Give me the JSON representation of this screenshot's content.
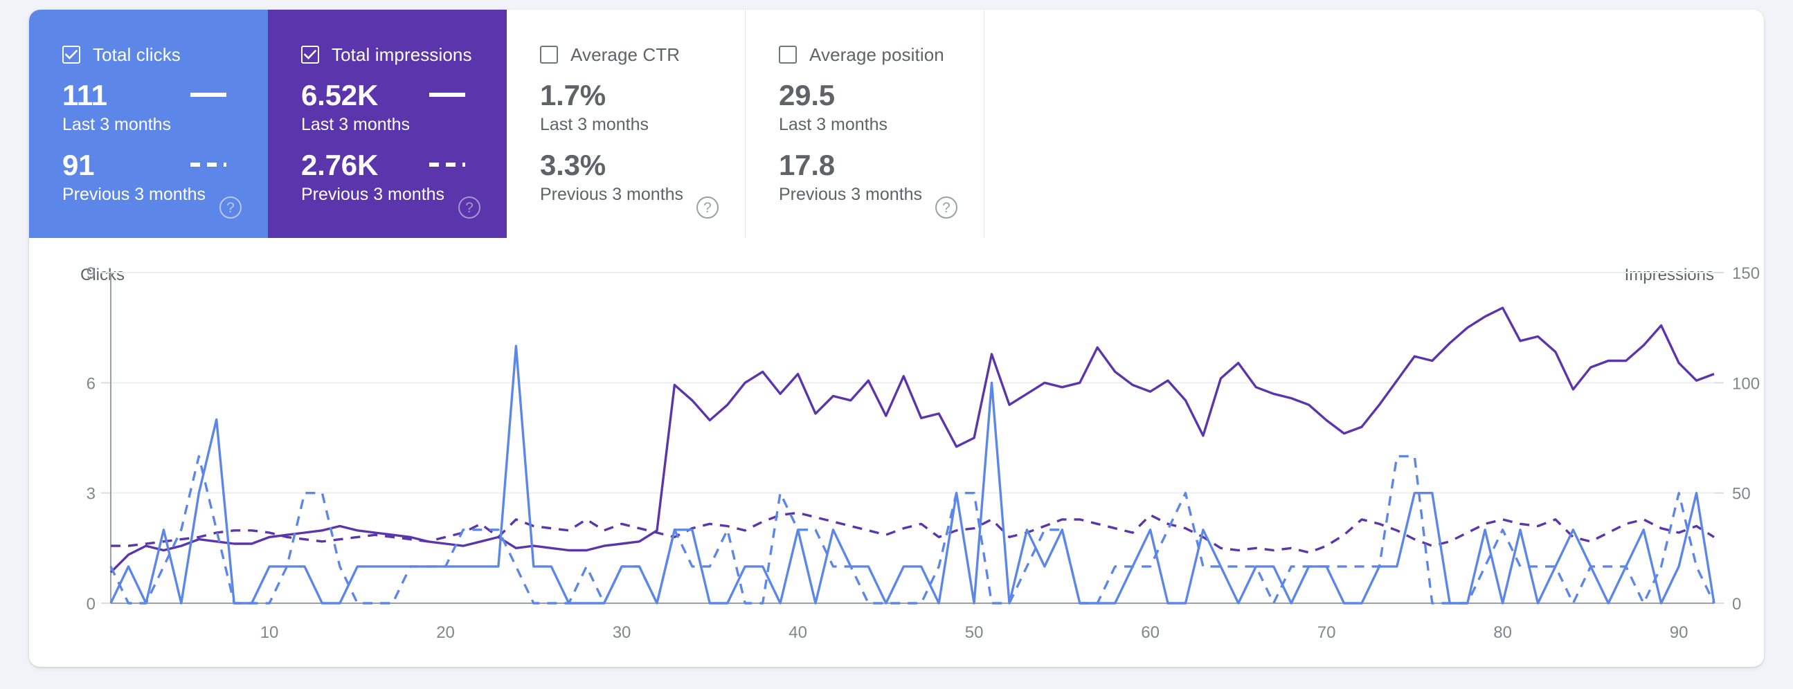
{
  "cards": [
    {
      "label": "Total clicks",
      "checked": true,
      "state": "active-clicks",
      "current_value": "111",
      "current_label": "Last 3 months",
      "previous_value": "91",
      "previous_label": "Previous 3 months",
      "help_glyph": "?",
      "accent": "#5c87e8"
    },
    {
      "label": "Total impressions",
      "checked": true,
      "state": "active-impr",
      "current_value": "6.52K",
      "current_label": "Last 3 months",
      "previous_value": "2.76K",
      "previous_label": "Previous 3 months",
      "help_glyph": "?",
      "accent": "#5b35ab"
    },
    {
      "label": "Average CTR",
      "checked": false,
      "state": "",
      "current_value": "1.7%",
      "current_label": "Last 3 months",
      "previous_value": "3.3%",
      "previous_label": "Previous 3 months",
      "help_glyph": "?",
      "accent": "#ffffff"
    },
    {
      "label": "Average position",
      "checked": false,
      "state": "",
      "current_value": "29.5",
      "current_label": "Last 3 months",
      "previous_value": "17.8",
      "previous_label": "Previous 3 months",
      "help_glyph": "?",
      "accent": "#ffffff"
    }
  ],
  "chart_data": {
    "type": "line",
    "title": "",
    "xlabel": "",
    "ylabel": "Clicks",
    "y2label": "Impressions",
    "ylim": [
      0,
      9
    ],
    "y2lim": [
      0,
      150
    ],
    "yticks": [
      "0",
      "3",
      "6",
      "9"
    ],
    "y2ticks": [
      "0",
      "50",
      "100",
      "150"
    ],
    "xticks": [
      "10",
      "20",
      "30",
      "40",
      "50",
      "60",
      "70",
      "80",
      "90"
    ],
    "xlim": [
      1,
      92
    ],
    "grid": true,
    "legend_position": "none",
    "series": [
      {
        "name": "Total clicks",
        "axis": "left",
        "color": "#5c87e8",
        "style": "solid",
        "values": [
          0,
          1,
          0,
          2,
          0,
          3,
          5,
          0,
          0,
          1,
          1,
          1,
          0,
          0,
          1,
          1,
          1,
          1,
          1,
          1,
          1,
          1,
          1,
          7,
          1,
          1,
          0,
          0,
          0,
          1,
          1,
          0,
          2,
          2,
          0,
          0,
          1,
          1,
          0,
          2,
          0,
          2,
          1,
          1,
          0,
          1,
          1,
          0,
          3,
          0,
          6,
          0,
          2,
          1,
          2,
          0,
          0,
          0,
          1,
          2,
          0,
          0,
          2,
          1,
          0,
          1,
          1,
          0,
          1,
          1,
          0,
          0,
          1,
          1,
          3,
          3,
          0,
          0,
          2,
          0,
          2,
          0,
          1,
          2,
          1,
          0,
          1,
          2,
          0,
          1,
          3,
          0
        ]
      },
      {
        "name": "Total clicks (previous)",
        "axis": "left",
        "color": "#5c87e8",
        "style": "dashed",
        "values": [
          1,
          0,
          0,
          1,
          2,
          4,
          2,
          0,
          0,
          0,
          1,
          3,
          3,
          1,
          0,
          0,
          0,
          1,
          1,
          1,
          2,
          2,
          2,
          1,
          0,
          0,
          0,
          1,
          0,
          1,
          1,
          0,
          2,
          1,
          1,
          2,
          0,
          0,
          3,
          2,
          2,
          1,
          1,
          0,
          0,
          0,
          0,
          1,
          3,
          3,
          0,
          0,
          1,
          2,
          2,
          0,
          0,
          1,
          1,
          1,
          2,
          3,
          1,
          1,
          1,
          1,
          0,
          1,
          1,
          1,
          1,
          1,
          1,
          4,
          4,
          0,
          0,
          0,
          1,
          2,
          1,
          1,
          1,
          0,
          1,
          1,
          1,
          0,
          1,
          3,
          1,
          0
        ]
      },
      {
        "name": "Total impressions",
        "axis": "right",
        "color": "#5b35ab",
        "style": "solid",
        "values": [
          14,
          22,
          26,
          24,
          26,
          29,
          28,
          27,
          27,
          30,
          31,
          32,
          33,
          35,
          33,
          32,
          31,
          30,
          28,
          27,
          26,
          28,
          30,
          25,
          26,
          25,
          24,
          24,
          26,
          27,
          28,
          33,
          99,
          92,
          83,
          90,
          100,
          105,
          95,
          104,
          86,
          94,
          92,
          101,
          85,
          103,
          84,
          86,
          71,
          75,
          113,
          90,
          95,
          100,
          98,
          100,
          116,
          105,
          99,
          96,
          101,
          92,
          76,
          102,
          109,
          98,
          95,
          93,
          90,
          83,
          77,
          80,
          90,
          101,
          112,
          110,
          118,
          125,
          130,
          134,
          119,
          121,
          114,
          97,
          107,
          110,
          110,
          117,
          126,
          109,
          101,
          104
        ]
      },
      {
        "name": "Total impressions (previous)",
        "axis": "right",
        "color": "#5b35ab",
        "style": "dashed",
        "values": [
          26,
          26,
          27,
          28,
          29,
          30,
          32,
          33,
          33,
          32,
          30,
          29,
          28,
          29,
          30,
          31,
          30,
          29,
          28,
          30,
          32,
          36,
          30,
          38,
          35,
          34,
          33,
          38,
          33,
          36,
          34,
          32,
          30,
          34,
          36,
          35,
          33,
          37,
          40,
          41,
          39,
          37,
          35,
          33,
          31,
          34,
          36,
          30,
          33,
          34,
          38,
          30,
          32,
          35,
          38,
          38,
          36,
          34,
          32,
          40,
          36,
          34,
          30,
          25,
          24,
          25,
          24,
          25,
          23,
          26,
          31,
          38,
          36,
          33,
          29,
          26,
          28,
          32,
          36,
          38,
          36,
          35,
          38,
          30,
          28,
          32,
          36,
          38,
          34,
          32,
          35,
          30
        ]
      }
    ]
  }
}
